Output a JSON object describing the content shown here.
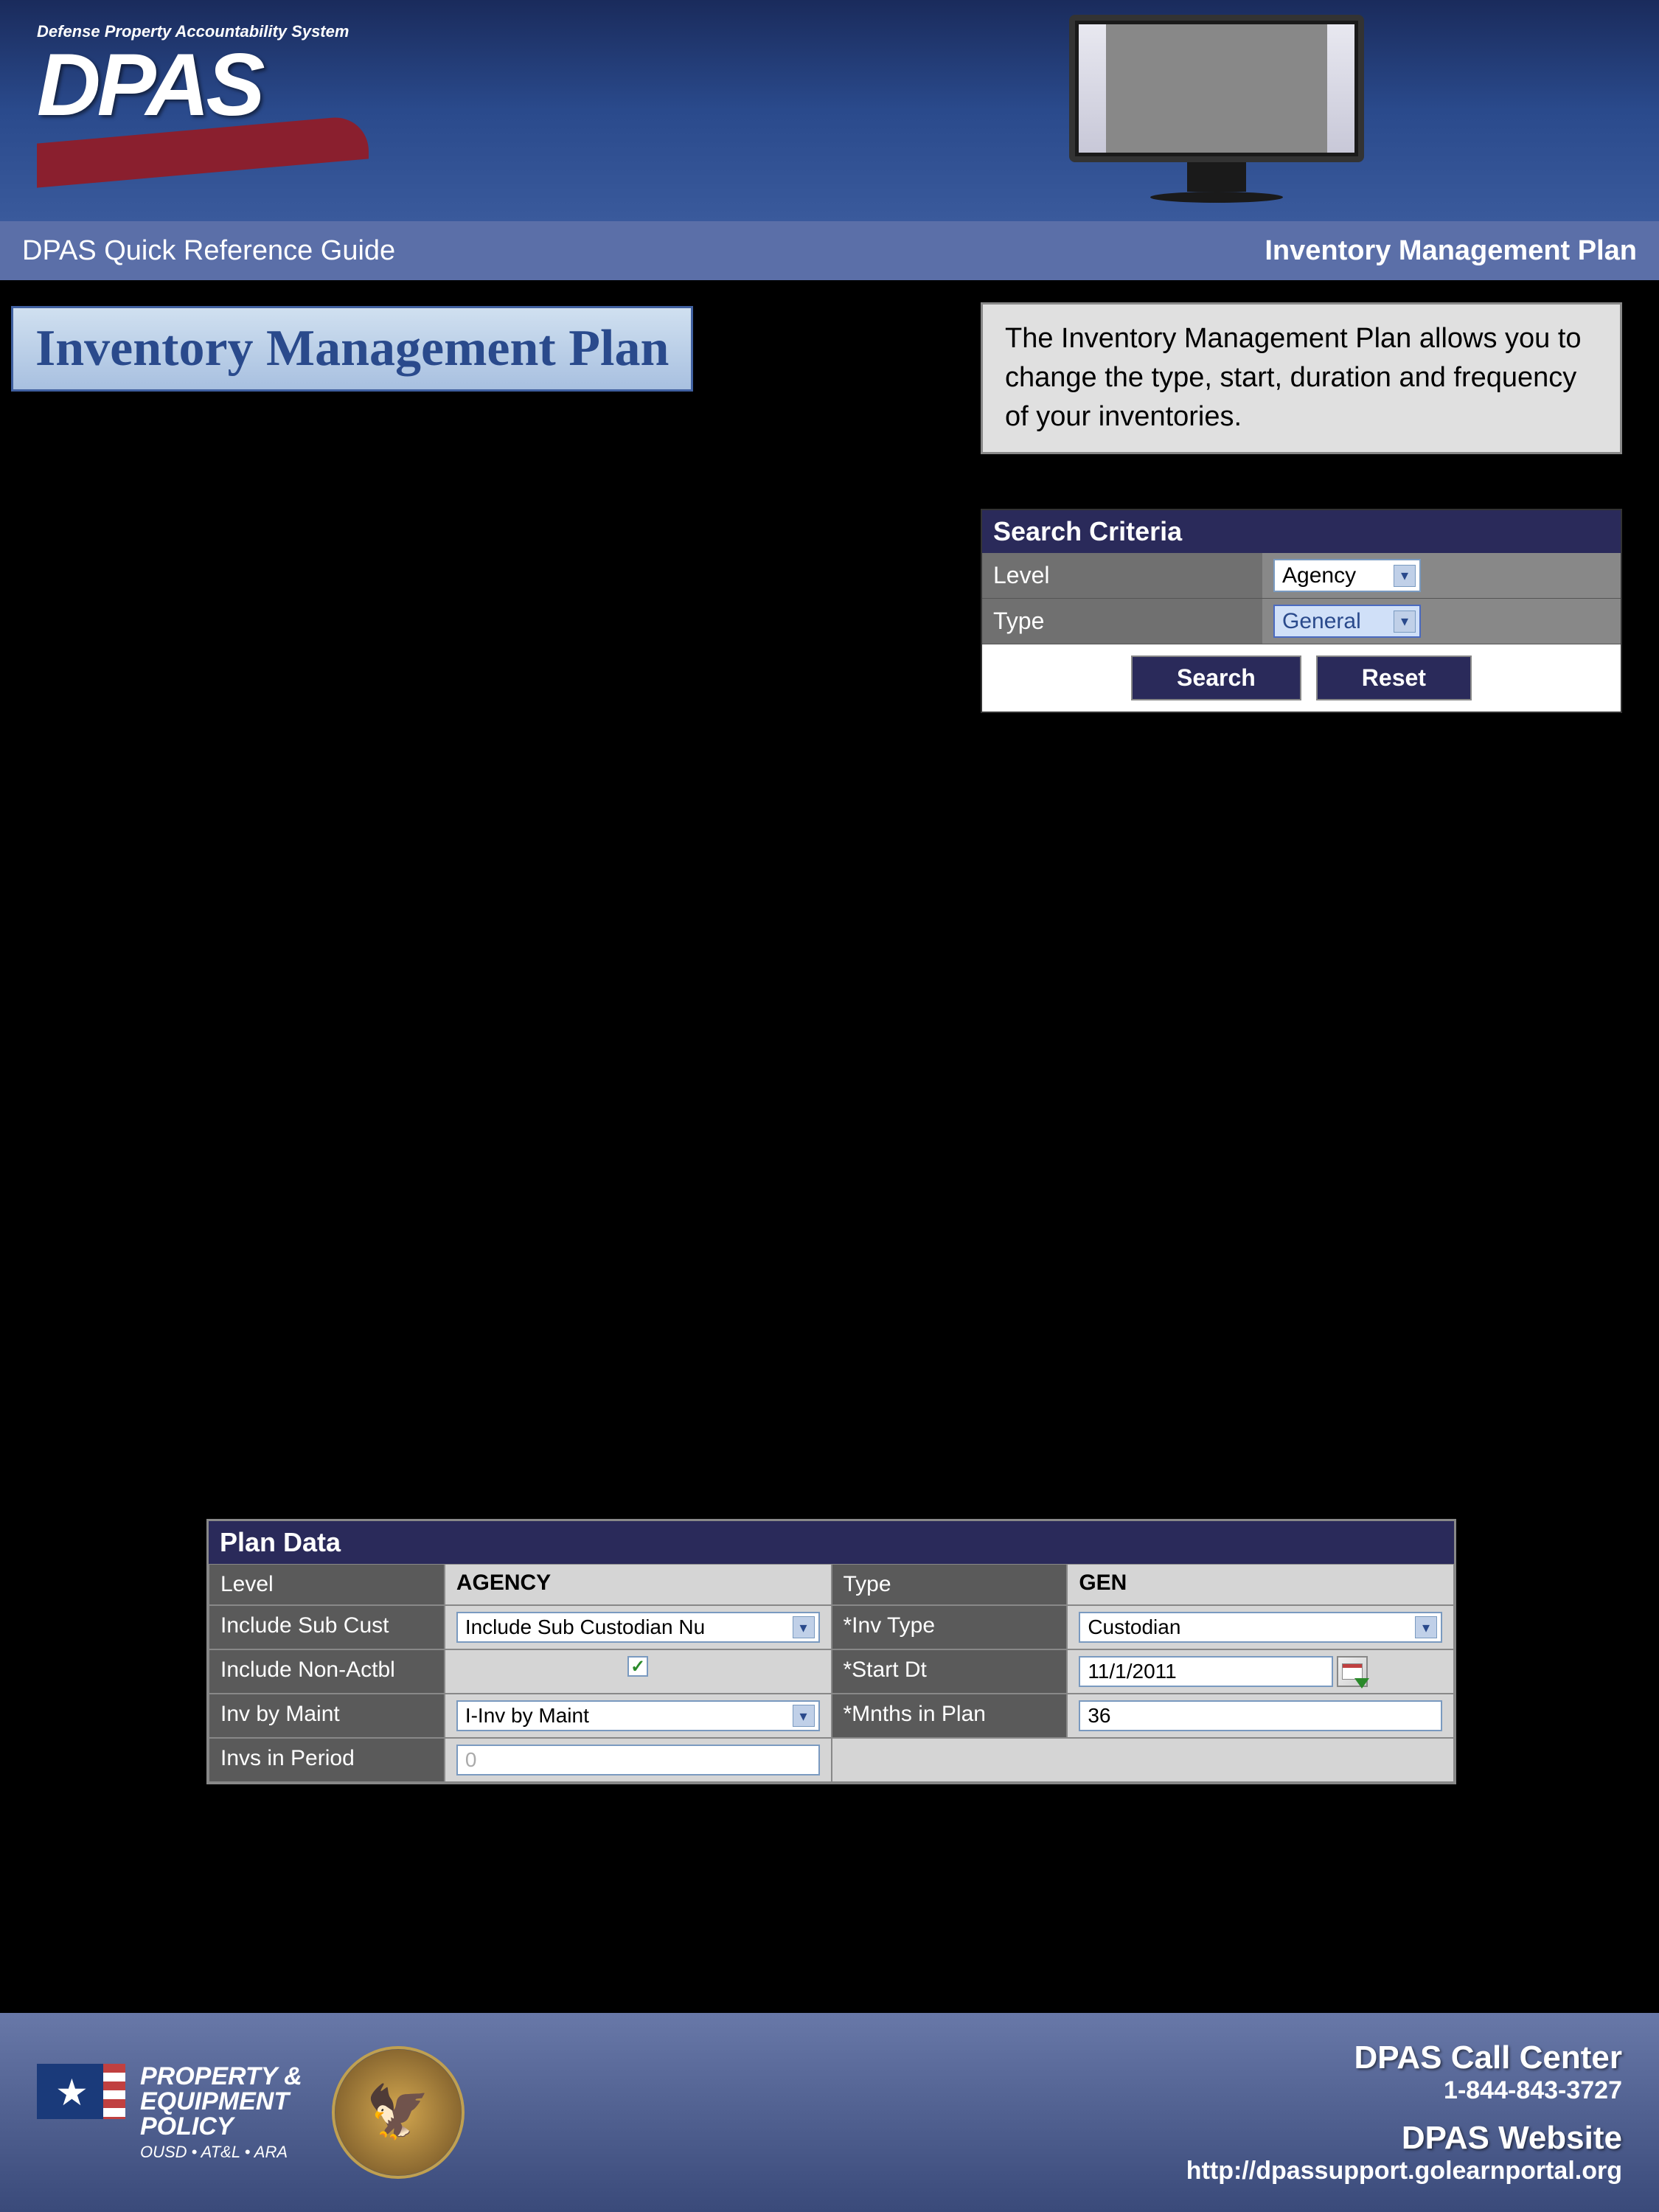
{
  "header": {
    "tagline": "Defense Property Accountability System",
    "logo": "DPAS"
  },
  "subheader": {
    "left": "DPAS Quick Reference Guide",
    "right": "Inventory Management Plan"
  },
  "title": "Inventory Management Plan",
  "intro": "The Inventory Management Plan allows you to change the type, start, duration and frequency of your inventories.",
  "search_criteria": {
    "header": "Search Criteria",
    "level_label": "Level",
    "level_value": "Agency",
    "type_label": "Type",
    "type_value": "General",
    "search_btn": "Search",
    "reset_btn": "Reset"
  },
  "plan_data": {
    "header": "Plan Data",
    "rows": {
      "level_label": "Level",
      "level_value": "AGENCY",
      "type_label": "Type",
      "type_value": "GEN",
      "include_sub_cust_label": "Include Sub Cust",
      "include_sub_cust_value": "Include Sub Custodian Nu",
      "inv_type_label": "*Inv Type",
      "inv_type_value": "Custodian",
      "include_non_actbl_label": "Include Non-Actbl",
      "include_non_actbl_checked": "✓",
      "start_dt_label": "*Start Dt",
      "start_dt_value": "11/1/2011",
      "inv_by_maint_label": "Inv by Maint",
      "inv_by_maint_value": "I-Inv by Maint",
      "mnths_in_plan_label": "*Mnths in Plan",
      "mnths_in_plan_value": "36",
      "invs_in_period_label": "Invs in Period",
      "invs_in_period_value": "0"
    }
  },
  "footer": {
    "pe_line1": "PROPERTY &",
    "pe_line2": "EQUIPMENT",
    "pe_line3": "POLICY",
    "pe_sub": "OUSD • AT&L • ARA",
    "call_center": "DPAS Call Center",
    "phone": "1-844-843-3727",
    "website_label": "DPAS Website",
    "website_url": "http://dpassupport.golearnportal.org"
  }
}
